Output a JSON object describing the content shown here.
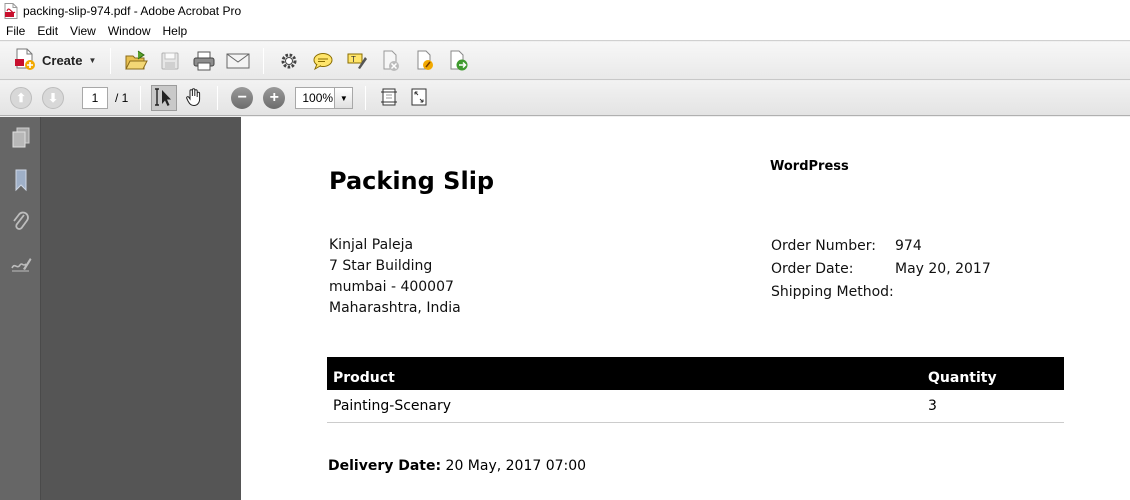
{
  "window": {
    "title": "packing-slip-974.pdf - Adobe Acrobat Pro"
  },
  "menu": [
    "File",
    "Edit",
    "View",
    "Window",
    "Help"
  ],
  "toolbar": {
    "create_label": "Create",
    "icons": [
      "open-folder-icon",
      "save-icon",
      "print-icon",
      "email-icon",
      "gear-icon",
      "comment-icon",
      "highlight-icon",
      "delete-file-icon",
      "edit-file-icon",
      "export-icon"
    ]
  },
  "navbar": {
    "page_current": "1",
    "page_total": "/ 1",
    "zoom": "100%"
  },
  "document": {
    "title": "Packing Slip",
    "shop_name": "WordPress",
    "address": [
      "Kinjal Paleja",
      "7 Star Building",
      "mumbai - 400007",
      "Maharashtra, India"
    ],
    "order": {
      "number_label": "Order Number:",
      "number": "974",
      "date_label": "Order Date:",
      "date": "May 20, 2017",
      "shipping_label": "Shipping Method:",
      "shipping": ""
    },
    "table": {
      "headers": [
        "Product",
        "Quantity"
      ],
      "rows": [
        [
          "Painting-Scenary",
          "3"
        ]
      ]
    },
    "delivery_label": "Delivery Date:",
    "delivery_value": " 20 May, 2017 07:00"
  },
  "colors": {
    "table_header": "#000000",
    "nav_panel": "#666666",
    "doc_background": "#555555"
  }
}
